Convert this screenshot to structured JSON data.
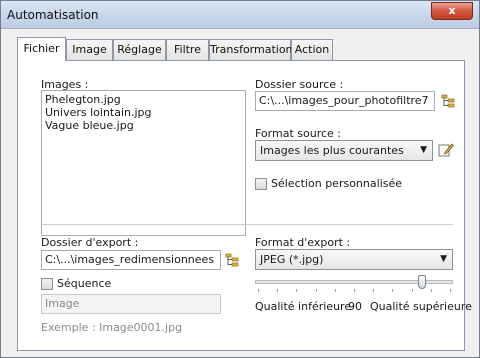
{
  "window": {
    "title": "Automatisation",
    "close_label": "x"
  },
  "tabs": [
    {
      "label": "Fichier",
      "active": true
    },
    {
      "label": "Image",
      "active": false
    },
    {
      "label": "Réglage",
      "active": false
    },
    {
      "label": "Filtre",
      "active": false
    },
    {
      "label": "Transformation",
      "active": false
    },
    {
      "label": "Action",
      "active": false
    }
  ],
  "images": {
    "label": "Images :",
    "files": [
      "Phelegton.jpg",
      "Univers lointain.jpg",
      "Vague bleue.jpg"
    ]
  },
  "source": {
    "folder_label": "Dossier source :",
    "folder_value": "C:\\...\\images_pour_photofiltre7",
    "format_label": "Format source :",
    "format_value": "Images les plus courantes",
    "custom_selection_label": "Sélection personnalisée",
    "custom_selection_checked": false
  },
  "export": {
    "folder_label": "Dossier d'export :",
    "folder_value": "C:\\...\\images_redimensionnees",
    "sequence_label": "Séquence",
    "sequence_checked": false,
    "sequence_name": "Image",
    "example_text": "Exemple : Image0001.jpg",
    "format_label": "Format d'export :",
    "format_value": "JPEG (*.jpg)",
    "quality_low_label": "Qualité inférieure",
    "quality_value": "90",
    "quality_high_label": "Qualité supérieure",
    "quality_fraction": 0.9
  },
  "icons": {
    "browse": "folder-tree-icon",
    "edit": "pencil-edit-icon"
  },
  "colors": {
    "titlebar": "#c7d6ea",
    "close_button": "#d2563f",
    "panel": "#ffffff"
  }
}
